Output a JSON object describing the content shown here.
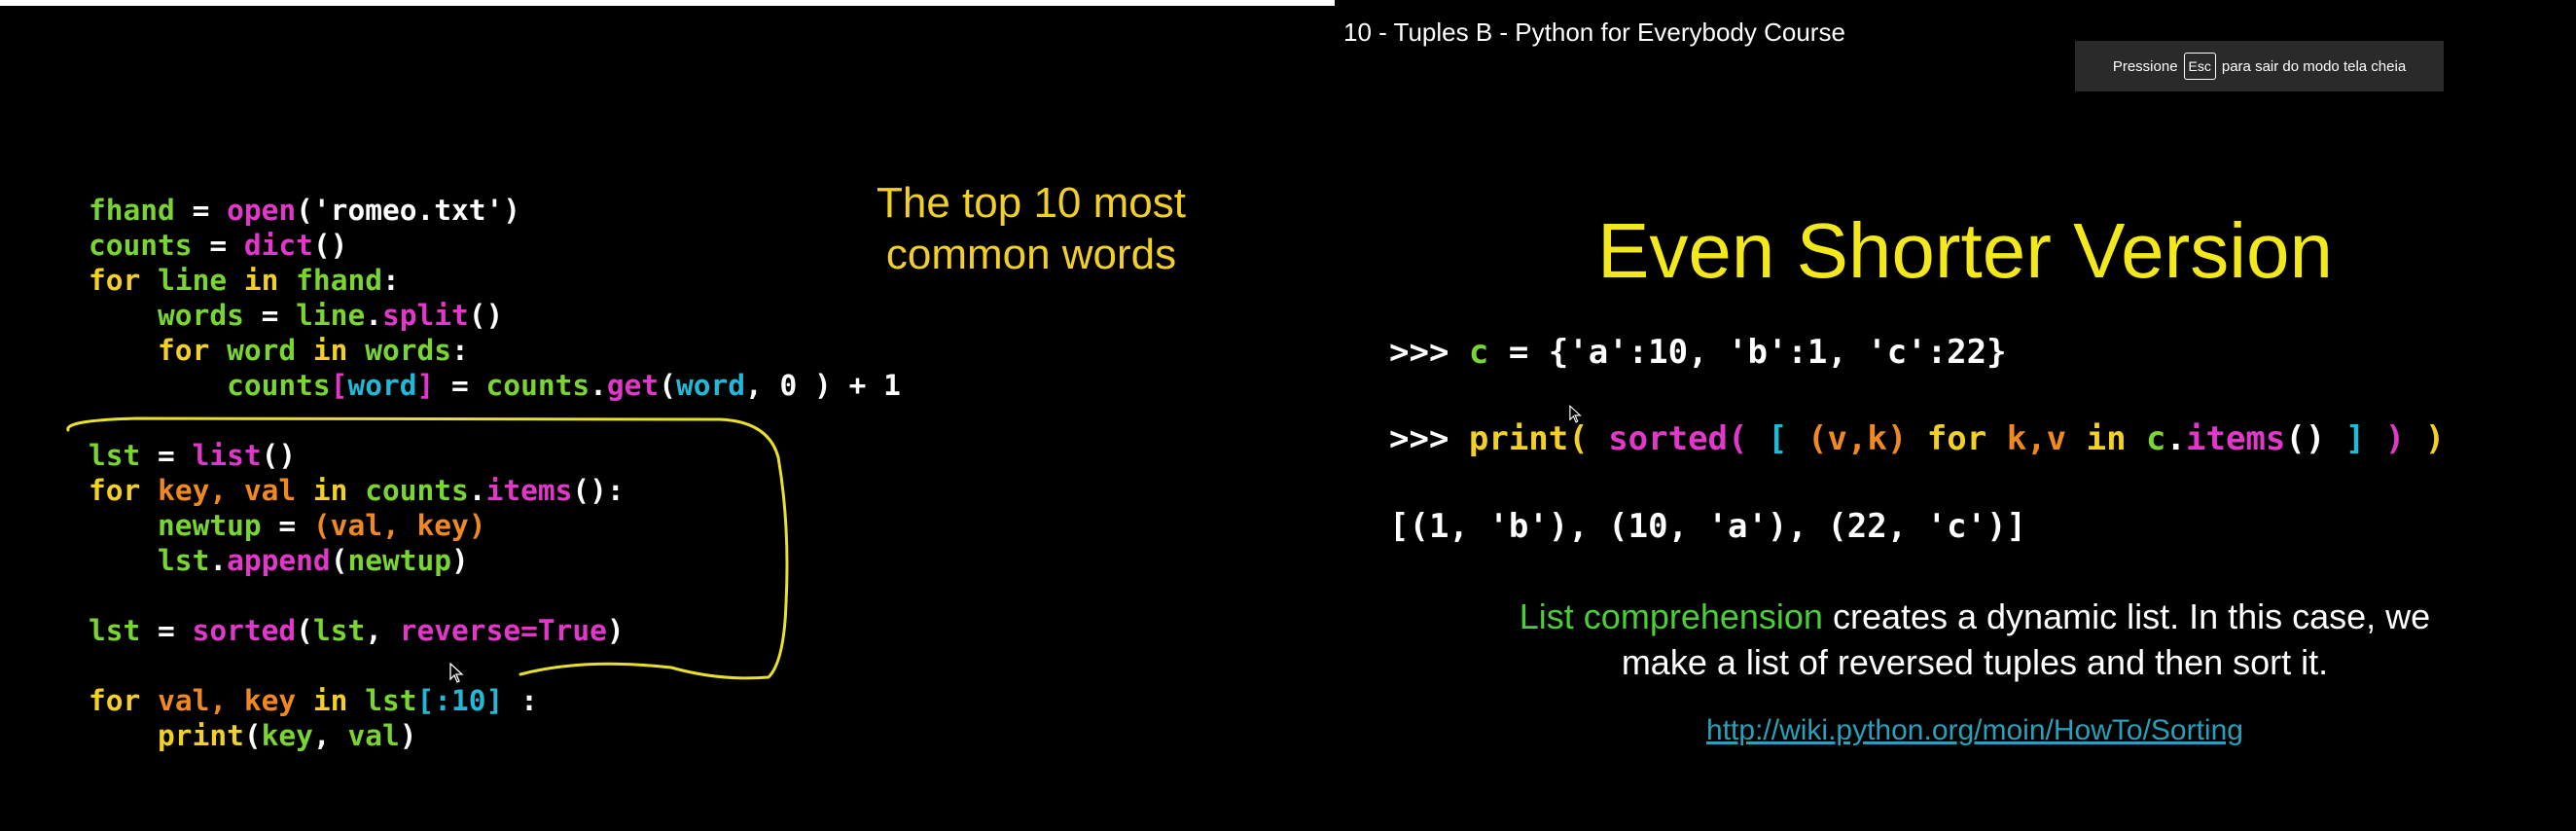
{
  "video": {
    "title": "10 - Tuples B - Python for Everybody Course"
  },
  "fullscreen_banner": {
    "prefix": "Pressione",
    "key": "Esc",
    "suffix": "para sair do modo tela cheia"
  },
  "left_slide": {
    "note_line1": "The top 10 most",
    "note_line2": "common words",
    "code": {
      "l1": [
        [
          "fhand",
          "green"
        ],
        [
          " = ",
          "white"
        ],
        [
          "open",
          "magenta"
        ],
        [
          "('romeo.txt')",
          "white"
        ]
      ],
      "l2": [
        [
          "counts",
          "green"
        ],
        [
          " = ",
          "white"
        ],
        [
          "dict",
          "magenta"
        ],
        [
          "()",
          "white"
        ]
      ],
      "l3": [
        [
          "for",
          "gold"
        ],
        [
          " ",
          "white"
        ],
        [
          "line",
          "green"
        ],
        [
          " ",
          "white"
        ],
        [
          "in",
          "gold"
        ],
        [
          " ",
          "white"
        ],
        [
          "fhand",
          "green"
        ],
        [
          ":",
          "white"
        ]
      ],
      "l4": [
        [
          "    ",
          "white"
        ],
        [
          "words",
          "green"
        ],
        [
          " = ",
          "white"
        ],
        [
          "line",
          "green"
        ],
        [
          ".",
          "white"
        ],
        [
          "split",
          "magenta"
        ],
        [
          "()",
          "white"
        ]
      ],
      "l5": [
        [
          "    ",
          "white"
        ],
        [
          "for",
          "gold"
        ],
        [
          " ",
          "white"
        ],
        [
          "word",
          "green"
        ],
        [
          " ",
          "white"
        ],
        [
          "in",
          "gold"
        ],
        [
          " ",
          "white"
        ],
        [
          "words",
          "green"
        ],
        [
          ":",
          "white"
        ]
      ],
      "l6": [
        [
          "        ",
          "white"
        ],
        [
          "counts",
          "green"
        ],
        [
          "[",
          "magenta"
        ],
        [
          "word",
          "cyan"
        ],
        [
          "]",
          "magenta"
        ],
        [
          " = ",
          "white"
        ],
        [
          "counts",
          "green"
        ],
        [
          ".",
          "white"
        ],
        [
          "get",
          "magenta"
        ],
        [
          "(",
          "white"
        ],
        [
          "word",
          "cyan"
        ],
        [
          ", 0 ) + 1",
          "white"
        ]
      ],
      "l7": [
        [
          "lst",
          "green"
        ],
        [
          " = ",
          "white"
        ],
        [
          "list",
          "magenta"
        ],
        [
          "()",
          "white"
        ]
      ],
      "l8": [
        [
          "for",
          "gold"
        ],
        [
          " ",
          "white"
        ],
        [
          "key, val",
          "orange"
        ],
        [
          " ",
          "white"
        ],
        [
          "in",
          "gold"
        ],
        [
          " ",
          "white"
        ],
        [
          "counts",
          "green"
        ],
        [
          ".",
          "white"
        ],
        [
          "items",
          "magenta"
        ],
        [
          "():",
          "white"
        ]
      ],
      "l9": [
        [
          "    ",
          "white"
        ],
        [
          "newtup",
          "green"
        ],
        [
          " = ",
          "white"
        ],
        [
          "(val, key)",
          "orange"
        ]
      ],
      "l10": [
        [
          "    ",
          "white"
        ],
        [
          "lst",
          "green"
        ],
        [
          ".",
          "white"
        ],
        [
          "append",
          "magenta"
        ],
        [
          "(",
          "white"
        ],
        [
          "newtup",
          "green"
        ],
        [
          ")",
          "white"
        ]
      ],
      "l11": [
        [
          "lst",
          "green"
        ],
        [
          " = ",
          "white"
        ],
        [
          "sorted",
          "magenta"
        ],
        [
          "(",
          "white"
        ],
        [
          "lst",
          "green"
        ],
        [
          ", ",
          "white"
        ],
        [
          "reverse=True",
          "magenta"
        ],
        [
          ")",
          "white"
        ]
      ],
      "l12": [
        [
          "for",
          "gold"
        ],
        [
          " ",
          "white"
        ],
        [
          "val, key",
          "orange"
        ],
        [
          " ",
          "white"
        ],
        [
          "in",
          "gold"
        ],
        [
          " ",
          "white"
        ],
        [
          "lst",
          "green"
        ],
        [
          "[:10]",
          "cyan"
        ],
        [
          " :",
          "white"
        ]
      ],
      "l13": [
        [
          "    ",
          "white"
        ],
        [
          "print",
          "gold"
        ],
        [
          "(",
          "white"
        ],
        [
          "key",
          "green"
        ],
        [
          ", ",
          "white"
        ],
        [
          "val",
          "green"
        ],
        [
          ")",
          "white"
        ]
      ]
    }
  },
  "right_slide": {
    "title": "Even Shorter Version",
    "repl": {
      "r1": [
        [
          ">>> ",
          "white"
        ],
        [
          "c",
          "green"
        ],
        [
          " = {'a':10, 'b':1, 'c':22}",
          "white"
        ]
      ],
      "r2": [
        [
          ">>> ",
          "white"
        ],
        [
          "print",
          "gold"
        ],
        [
          "( ",
          "gold"
        ],
        [
          "sorted",
          "magenta"
        ],
        [
          "( ",
          "magenta"
        ],
        [
          "[ ",
          "cyan"
        ],
        [
          "(v,k)",
          "orange"
        ],
        [
          " ",
          "white"
        ],
        [
          "for",
          "gold"
        ],
        [
          " ",
          "white"
        ],
        [
          "k,v",
          "orange"
        ],
        [
          " ",
          "white"
        ],
        [
          "in",
          "gold"
        ],
        [
          " ",
          "white"
        ],
        [
          "c",
          "green"
        ],
        [
          ".",
          "white"
        ],
        [
          "items",
          "magenta"
        ],
        [
          "()",
          "white"
        ],
        [
          " ]",
          "cyan"
        ],
        [
          " )",
          "magenta"
        ],
        [
          " )",
          "gold"
        ]
      ],
      "r3": [
        [
          "[(1, 'b'), (10, 'a'), (22, 'c')]",
          "white"
        ]
      ]
    },
    "explain_highlight": "List comprehension",
    "explain_rest_1": " creates a dynamic list.  In this case, we",
    "explain_line2": "make a list of reversed tuples and then sort it.",
    "link": "http://wiki.python.org/moin/HowTo/Sorting"
  },
  "colors": {
    "green": "#7ad432",
    "gold": "#f2d027",
    "magenta": "#e238c9",
    "white": "#ffffff",
    "cyan": "#22b8d8",
    "orange": "#f08a20",
    "title_yellow": "#f2e81b",
    "link_teal": "#2aa0b8",
    "annotation_yellow": "#e8e02a"
  },
  "icons": [
    "mouse-cursor-icon",
    "key-esc-icon"
  ]
}
